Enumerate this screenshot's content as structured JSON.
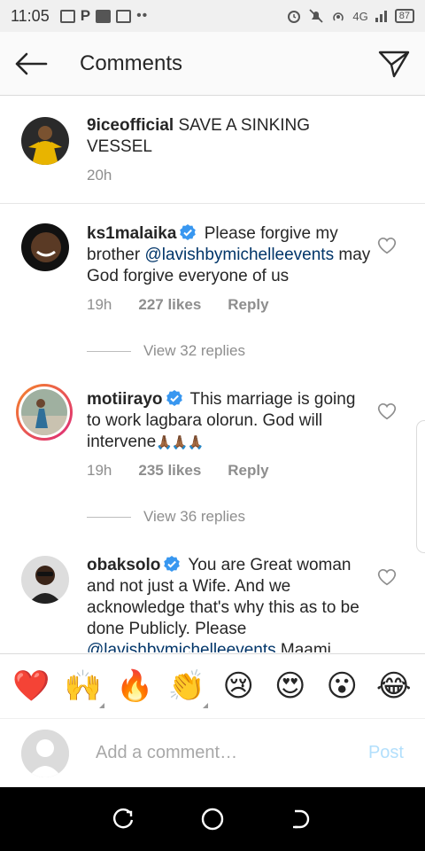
{
  "status_bar": {
    "time": "11:05",
    "network": "4G",
    "battery": "87"
  },
  "header": {
    "title": "Comments"
  },
  "caption": {
    "username": "9iceofficial",
    "text": "SAVE A SINKING VESSEL",
    "time": "20h"
  },
  "comments": [
    {
      "username": "ks1malaika",
      "verified": true,
      "text_before": "Please forgive my brother ",
      "mention": "@lavishbymichelleevents",
      "text_after": " may God forgive everyone of us",
      "time": "19h",
      "likes": "227 likes",
      "reply": "Reply",
      "view_replies": "View 32 replies"
    },
    {
      "username": "motiirayo",
      "verified": true,
      "text_before": "This marriage is going to work lagbara olorun. God will intervene",
      "emojis": "🙏🏾🙏🏾🙏🏾",
      "time": "19h",
      "likes": "235 likes",
      "reply": "Reply",
      "view_replies": "View 36 replies"
    },
    {
      "username": "obaksolo",
      "verified": true,
      "text_before": "You are Great woman and not just a Wife. And we acknowledge that's why this as to be done Publicly. Please ",
      "mention": "@lavishbymichelleevents",
      "text_after": " Maami"
    }
  ],
  "emoji_bar": [
    "❤️",
    "🙌",
    "🔥",
    "👏",
    "😢",
    "😍",
    "😮",
    "😂"
  ],
  "composer": {
    "placeholder": "Add a comment…",
    "post": "Post"
  },
  "colors": {
    "link": "#003569",
    "muted": "#8e8e8e",
    "verified_blue": "#3897f0",
    "post_disabled": "#b2dffc",
    "story_ring_start": "#f58529",
    "story_ring_end": "#dd2a7b"
  }
}
